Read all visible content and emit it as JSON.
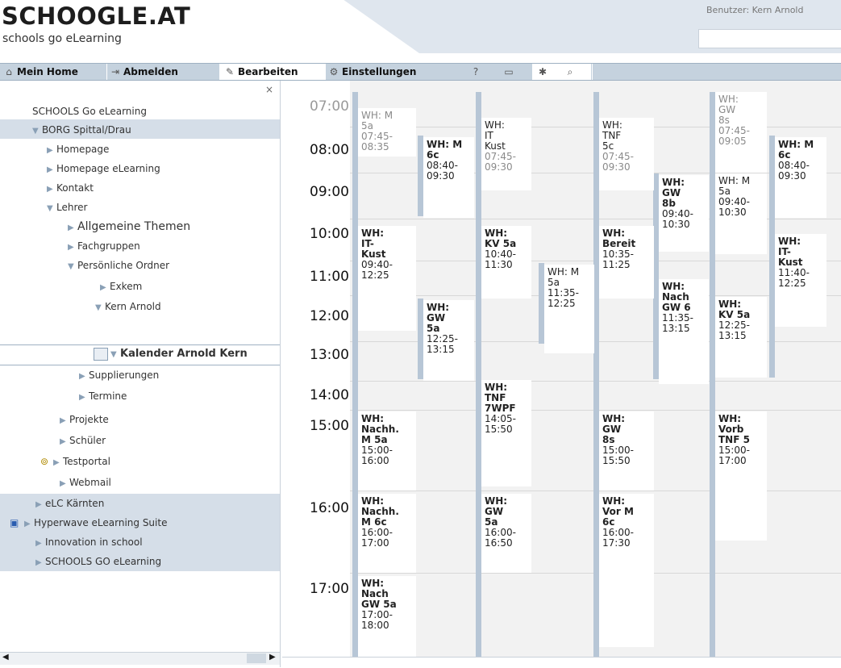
{
  "header": {
    "logo": "SCHOOGLE.AT",
    "subtitle": "schools go eLearning",
    "user_label": "Benutzer: Kern Arnold"
  },
  "toolbar": {
    "home": "Mein Home",
    "logout": "Abmelden",
    "edit": "Bearbeiten",
    "settings": "Einstellungen"
  },
  "sidebar": {
    "items": [
      {
        "label": "SCHOOLS Go eLearning"
      },
      {
        "label": "BORG Spittal/Drau"
      },
      {
        "label": "Homepage"
      },
      {
        "label": "Homepage eLearning"
      },
      {
        "label": "Kontakt"
      },
      {
        "label": "Lehrer"
      },
      {
        "label": "Allgemeine Themen"
      },
      {
        "label": "Fachgruppen"
      },
      {
        "label": "Persönliche Ordner"
      },
      {
        "label": "Exkem"
      },
      {
        "label": "Kern Arnold"
      },
      {
        "label": "Kalender Arnold Kern"
      },
      {
        "label": "Supplierungen"
      },
      {
        "label": "Termine"
      },
      {
        "label": "Projekte"
      },
      {
        "label": "Schüler"
      },
      {
        "label": "Testportal"
      },
      {
        "label": "Webmail"
      },
      {
        "label": "eLC Kärnten"
      },
      {
        "label": "Hyperwave eLearning Suite"
      },
      {
        "label": "Innovation in school"
      },
      {
        "label": "SCHOOLS GO eLearning"
      }
    ]
  },
  "calendar": {
    "hours": [
      "07:00",
      "08:00",
      "09:00",
      "10:00",
      "11:00",
      "12:00",
      "13:00",
      "14:00",
      "15:00",
      "16:00",
      "17:00"
    ],
    "events": [
      {
        "text": "WH: M\n5a\n07:45-\n08:35"
      },
      {
        "title": "WH: M\n6c",
        "time": "08:40-\n09:30"
      },
      {
        "title": "WH:\nIT\nKust",
        "time": "07:45-\n09:30"
      },
      {
        "title": "WH:\nTNF\n5c",
        "time": "07:45-\n09:30"
      },
      {
        "title": "WH:\nGW\n8s",
        "time": "07:45-\n09:05"
      },
      {
        "title": "WH: M\n6c",
        "time": "08:40-\n09:30"
      },
      {
        "title": "WH:\nGW\n8b",
        "time": "09:40-\n10:30"
      },
      {
        "title": "WH: M\n5a",
        "time": "09:40-\n10:30"
      },
      {
        "title": "WH:\nIT-\nKust",
        "time": "09:40-\n12:25"
      },
      {
        "title": "WH:\nKV 5a",
        "time": "10:40-\n11:30"
      },
      {
        "title": "WH:\nBereit",
        "time": "10:35-\n11:25"
      },
      {
        "title": "WH:\nIT-\nKust",
        "time": "11:40-\n12:25"
      },
      {
        "title": "WH: M\n5a",
        "time": "11:35-\n12:25"
      },
      {
        "title": "WH:\nNach\nGW 6",
        "time": "11:35-\n13:15"
      },
      {
        "title": "WH:\nGW\n5a",
        "time": "12:25-\n13:15"
      },
      {
        "title": "WH:\nKV 5a",
        "time": "12:25-\n13:15"
      },
      {
        "title": "WH:\nTNF\n7WPF",
        "time": "14:05-\n15:50"
      },
      {
        "title": "WH:\nNachh.\nM 5a",
        "time": "15:00-\n16:00"
      },
      {
        "title": "WH:\nGW\n8s",
        "time": "15:00-\n15:50"
      },
      {
        "title": "WH:\nVorb\nTNF 5",
        "time": "15:00-\n17:00"
      },
      {
        "title": "WH:\nNachh.\nM 6c",
        "time": "16:00-\n17:00"
      },
      {
        "title": "WH:\nGW\n5a",
        "time": "16:00-\n16:50"
      },
      {
        "title": "WH:\nVor M\n6c",
        "time": "16:00-\n17:30"
      },
      {
        "title": "WH:\nNach\nGW 5a",
        "time": "17:00-\n18:00"
      }
    ]
  }
}
